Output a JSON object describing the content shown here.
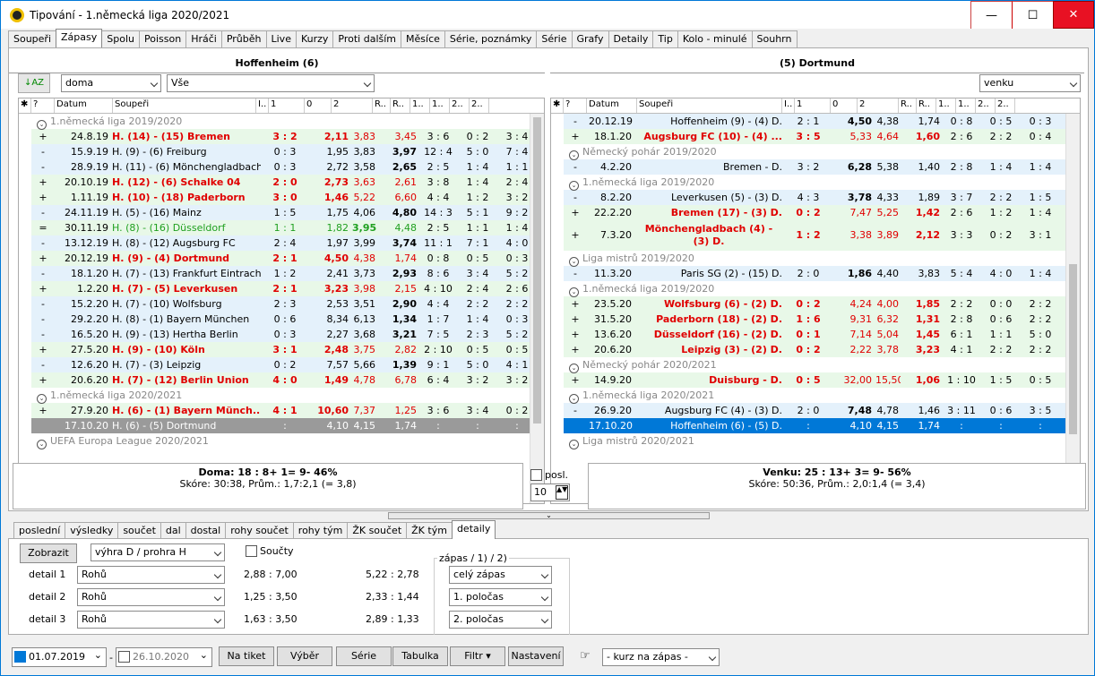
{
  "title": "Tipování - 1.německá liga 2020/2021",
  "tabs": [
    "Soupeři",
    "Zápasy",
    "Spolu",
    "Poisson",
    "Hráči",
    "Průběh",
    "Live",
    "Kurzy",
    "Proti dalším",
    "Měsíce",
    "Série, poznámky",
    "Série",
    "Grafy",
    "Detaily",
    "Tip",
    "Kolo - minulé",
    "Souhrn"
  ],
  "home": {
    "header": "Hoffenheim (6)",
    "filter1": "doma",
    "filter2": "Vše",
    "cols": [
      "?",
      "Datum",
      "Soupeři",
      "I..",
      "1",
      "0",
      "2",
      "R..",
      "R..",
      "1..",
      "1..",
      "2..",
      "2.."
    ],
    "rows": [
      {
        "t": "grp",
        "text": "1.německá liga 2019/2020"
      },
      {
        "c": "g",
        "s": "+",
        "d": "24.8.19",
        "o": "H. (14) - (15) Bremen",
        "red": true,
        "sc": "3 : 2",
        "k1": "2,11",
        "k0": "3,83",
        "k2": "3,45",
        "b": "1",
        "r": "3 : 6",
        "h": "0 : 2",
        "h2": "3 : 4"
      },
      {
        "c": "b",
        "s": "-",
        "d": "15.9.19",
        "o": "H. (9) - (6) Freiburg",
        "sc": "0 : 3",
        "k1": "1,95",
        "k0": "3,83",
        "k2": "3,97",
        "b": "2",
        "r": "12 : 4",
        "h": "5 : 0",
        "h2": "7 : 4"
      },
      {
        "c": "b",
        "s": "-",
        "d": "28.9.19",
        "o": "H. (11) - (6) Mönchengladbach",
        "sc": "0 : 3",
        "k1": "2,72",
        "k0": "3,58",
        "k2": "2,65",
        "b": "2",
        "r": "2 : 5",
        "h": "1 : 4",
        "h2": "1 : 1"
      },
      {
        "c": "g",
        "s": "+",
        "d": "20.10.19",
        "o": "H. (12) - (6) Schalke 04",
        "red": true,
        "sc": "2 : 0",
        "k1": "2,73",
        "k0": "3,63",
        "k2": "2,61",
        "b": "1",
        "r": "3 : 8",
        "h": "1 : 4",
        "h2": "2 : 4"
      },
      {
        "c": "g",
        "s": "+",
        "d": "1.11.19",
        "o": "H. (10) - (18) Paderborn",
        "red": true,
        "sc": "3 : 0",
        "k1": "1,46",
        "k0": "5,22",
        "k2": "6,60",
        "b": "1",
        "r": "4 : 4",
        "h": "1 : 2",
        "h2": "3 : 2"
      },
      {
        "c": "b",
        "s": "-",
        "d": "24.11.19",
        "o": "H. (5) - (16) Mainz",
        "sc": "1 : 5",
        "k1": "1,75",
        "k0": "4,06",
        "k2": "4,80",
        "b": "2",
        "r": "14 : 3",
        "h": "5 : 1",
        "h2": "9 : 2"
      },
      {
        "c": "g",
        "s": "=",
        "d": "30.11.19",
        "o": "H. (8) - (16) Düsseldorf",
        "grn": true,
        "sc": "1 : 1",
        "k1": "1,82",
        "k0": "3,95",
        "k2": "4,48",
        "b": "0",
        "r": "2 : 5",
        "h": "1 : 1",
        "h2": "1 : 4"
      },
      {
        "c": "b",
        "s": "-",
        "d": "13.12.19",
        "o": "H. (8) - (12) Augsburg FC",
        "sc": "2 : 4",
        "k1": "1,97",
        "k0": "3,99",
        "k2": "3,74",
        "b": "2",
        "r": "11 : 1",
        "h": "7 : 1",
        "h2": "4 : 0"
      },
      {
        "c": "g",
        "s": "+",
        "d": "20.12.19",
        "o": "H. (9) - (4) Dortmund",
        "red": true,
        "sc": "2 : 1",
        "k1": "4,50",
        "k0": "4,38",
        "k2": "1,74",
        "b": "1",
        "r": "0 : 8",
        "h": "0 : 5",
        "h2": "0 : 3"
      },
      {
        "c": "b",
        "s": "-",
        "d": "18.1.20",
        "o": "H. (7) - (13) Frankfurt Eintracht",
        "sc": "1 : 2",
        "k1": "2,41",
        "k0": "3,73",
        "k2": "2,93",
        "b": "2",
        "r": "8 : 6",
        "h": "3 : 4",
        "h2": "5 : 2"
      },
      {
        "c": "g",
        "s": "+",
        "d": "1.2.20",
        "o": "H. (7) - (5) Leverkusen",
        "red": true,
        "sc": "2 : 1",
        "k1": "3,23",
        "k0": "3,98",
        "k2": "2,15",
        "b": "1",
        "r": "4 : 10",
        "h": "2 : 4",
        "h2": "2 : 6"
      },
      {
        "c": "b",
        "s": "-",
        "d": "15.2.20",
        "o": "H. (7) - (10) Wolfsburg",
        "sc": "2 : 3",
        "k1": "2,53",
        "k0": "3,51",
        "k2": "2,90",
        "b": "2",
        "r": "4 : 4",
        "h": "2 : 2",
        "h2": "2 : 2"
      },
      {
        "c": "b",
        "s": "-",
        "d": "29.2.20",
        "o": "H. (8) - (1) Bayern München",
        "sc": "0 : 6",
        "k1": "8,34",
        "k0": "6,13",
        "k2": "1,34",
        "b": "2",
        "r": "1 : 7",
        "h": "1 : 4",
        "h2": "0 : 3"
      },
      {
        "c": "b",
        "s": "-",
        "d": "16.5.20",
        "o": "H. (9) - (13) Hertha Berlin",
        "sc": "0 : 3",
        "k1": "2,27",
        "k0": "3,68",
        "k2": "3,21",
        "b": "2",
        "r": "7 : 5",
        "h": "2 : 3",
        "h2": "5 : 2"
      },
      {
        "c": "g",
        "s": "+",
        "d": "27.5.20",
        "o": "H. (9) - (10) Köln",
        "red": true,
        "sc": "3 : 1",
        "k1": "2,48",
        "k0": "3,75",
        "k2": "2,82",
        "b": "1",
        "r": "2 : 10",
        "h": "0 : 5",
        "h2": "0 : 5"
      },
      {
        "c": "b",
        "s": "-",
        "d": "12.6.20",
        "o": "H. (7) - (3) Leipzig",
        "sc": "0 : 2",
        "k1": "7,57",
        "k0": "5,66",
        "k2": "1,39",
        "b": "2",
        "r": "9 : 1",
        "h": "5 : 0",
        "h2": "4 : 1"
      },
      {
        "c": "g",
        "s": "+",
        "d": "20.6.20",
        "o": "H. (7) - (12) Berlin Union",
        "red": true,
        "sc": "4 : 0",
        "k1": "1,49",
        "k0": "4,78",
        "k2": "6,78",
        "b": "1",
        "r": "6 : 4",
        "h": "3 : 2",
        "h2": "3 : 2"
      },
      {
        "t": "grp",
        "text": "1.německá liga 2020/2021"
      },
      {
        "c": "g",
        "s": "+",
        "d": "27.9.20",
        "o": "H. (6) - (1) Bayern Münch...",
        "red": true,
        "sc": "4 : 1",
        "k1": "10,60",
        "k0": "7,37",
        "k2": "1,25",
        "b": "1",
        "r": "3 : 6",
        "h": "3 : 4",
        "h2": "0 : 2"
      },
      {
        "c": "gray",
        "s": "",
        "d": "17.10.20",
        "o": "H. (6) - (5) Dortmund",
        "sc": ":",
        "k1": "4,10",
        "k0": "4,15",
        "k2": "1,74",
        "b": "",
        "r": ":",
        "h": ":",
        "h2": ":"
      },
      {
        "t": "grp",
        "text": "UEFA Europa League 2020/2021"
      }
    ]
  },
  "away": {
    "header": "(5) Dortmund",
    "filter1": "venku",
    "rows": [
      {
        "c": "b",
        "s": "-",
        "d": "20.12.19",
        "o": "Hoffenheim (9) - (4) D.",
        "sc": "2 : 1",
        "k1": "4,50",
        "k0": "4,38",
        "k2": "1,74",
        "b": "1",
        "r": "0 : 8",
        "h": "0 : 5",
        "h2": "0 : 3"
      },
      {
        "c": "g",
        "s": "+",
        "d": "18.1.20",
        "o": "Augsburg FC (10) - (4) ...",
        "red": true,
        "sc": "3 : 5",
        "k1": "5,33",
        "k0": "4,64",
        "k2": "1,60",
        "b": "2",
        "r": "2 : 6",
        "h": "2 : 2",
        "h2": "0 : 4"
      },
      {
        "t": "grp",
        "text": "Německý pohár 2019/2020"
      },
      {
        "c": "b",
        "s": "-",
        "d": "4.2.20",
        "o": "Bremen - D.",
        "sc": "3 : 2",
        "k1": "6,28",
        "k0": "5,38",
        "k2": "1,40",
        "b": "1",
        "r": "2 : 8",
        "h": "1 : 4",
        "h2": "1 : 4"
      },
      {
        "t": "grp",
        "text": "1.německá liga 2019/2020"
      },
      {
        "c": "b",
        "s": "-",
        "d": "8.2.20",
        "o": "Leverkusen (5) - (3) D.",
        "sc": "4 : 3",
        "k1": "3,78",
        "k0": "4,33",
        "k2": "1,89",
        "b": "1",
        "r": "3 : 7",
        "h": "2 : 2",
        "h2": "1 : 5"
      },
      {
        "c": "g",
        "s": "+",
        "d": "22.2.20",
        "o": "Bremen (17) - (3) D.",
        "red": true,
        "sc": "0 : 2",
        "k1": "7,47",
        "k0": "5,25",
        "k2": "1,42",
        "b": "2",
        "r": "2 : 6",
        "h": "1 : 2",
        "h2": "1 : 4"
      },
      {
        "c": "g",
        "s": "+",
        "d": "7.3.20",
        "o": "Mönchengladbach (4) - (3) D.",
        "red": true,
        "tall": true,
        "sc": "1 : 2",
        "k1": "3,38",
        "k0": "3,89",
        "k2": "2,12",
        "b": "2",
        "r": "3 : 3",
        "h": "0 : 2",
        "h2": "3 : 1"
      },
      {
        "t": "grp",
        "text": "Liga mistrů 2019/2020"
      },
      {
        "c": "b",
        "s": "-",
        "d": "11.3.20",
        "o": "Paris SG (2) - (15) D.",
        "sc": "2 : 0",
        "k1": "1,86",
        "k0": "4,40",
        "k2": "3,83",
        "b": "1",
        "r": "5 : 4",
        "h": "4 : 0",
        "h2": "1 : 4"
      },
      {
        "t": "grp",
        "text": "1.německá liga 2019/2020"
      },
      {
        "c": "g",
        "s": "+",
        "d": "23.5.20",
        "o": "Wolfsburg (6) - (2) D.",
        "red": true,
        "sc": "0 : 2",
        "k1": "4,24",
        "k0": "4,00",
        "k2": "1,85",
        "b": "2",
        "r": "2 : 2",
        "h": "0 : 0",
        "h2": "2 : 2"
      },
      {
        "c": "g",
        "s": "+",
        "d": "31.5.20",
        "o": "Paderborn (18) - (2) D.",
        "red": true,
        "sc": "1 : 6",
        "k1": "9,31",
        "k0": "6,32",
        "k2": "1,31",
        "b": "2",
        "r": "2 : 8",
        "h": "0 : 6",
        "h2": "2 : 2"
      },
      {
        "c": "g",
        "s": "+",
        "d": "13.6.20",
        "o": "Düsseldorf (16) - (2) D.",
        "red": true,
        "sc": "0 : 1",
        "k1": "7,14",
        "k0": "5,04",
        "k2": "1,45",
        "b": "2",
        "r": "6 : 1",
        "h": "1 : 1",
        "h2": "5 : 0"
      },
      {
        "c": "g",
        "s": "+",
        "d": "20.6.20",
        "o": "Leipzig (3) - (2) D.",
        "red": true,
        "sc": "0 : 2",
        "k1": "2,22",
        "k0": "3,78",
        "k2": "3,23",
        "b": "2",
        "r": "4 : 1",
        "h": "2 : 2",
        "h2": "2 : 2"
      },
      {
        "t": "grp",
        "text": "Německý pohár 2020/2021"
      },
      {
        "c": "g",
        "s": "+",
        "d": "14.9.20",
        "o": "Duisburg - D.",
        "red": true,
        "sc": "0 : 5",
        "k1": "32,00",
        "k0": "15,50",
        "k2": "1,06",
        "b": "2",
        "r": "1 : 10",
        "h": "1 : 5",
        "h2": "0 : 5"
      },
      {
        "t": "grp",
        "text": "1.německá liga 2020/2021"
      },
      {
        "c": "b",
        "s": "-",
        "d": "26.9.20",
        "o": "Augsburg FC (4) - (3) D.",
        "sc": "2 : 0",
        "k1": "7,48",
        "k0": "4,78",
        "k2": "1,46",
        "b": "1",
        "r": "3 : 11",
        "h": "0 : 6",
        "h2": "3 : 5"
      },
      {
        "c": "sel",
        "s": "",
        "d": "17.10.20",
        "o": "Hoffenheim (6) - (5) D.",
        "sc": ":",
        "k1": "4,10",
        "k0": "4,15",
        "k2": "1,74",
        "b": "",
        "r": ":",
        "h": ":",
        "h2": ":"
      },
      {
        "t": "grp",
        "text": "Liga mistrů 2020/2021"
      }
    ]
  },
  "summary": {
    "home_line1": "Doma: 18 : 8+ 1= 9- 46%",
    "home_line2": "Skóre: 30:38, Prům.: 1,7:2,1 (= 3,8)",
    "away_line1": "Venku: 25 : 13+ 3= 9- 56%",
    "away_line2": "Skóre: 50:36, Prům.: 2,0:1,4 (= 3,4)",
    "posl_label": "posl.",
    "posl_value": "10"
  },
  "bottom_tabs": [
    "poslední",
    "výsledky",
    "součet",
    "dal",
    "dostal",
    "rohy součet",
    "rohy tým",
    "ŽK součet",
    "ŽK tým",
    "detaily"
  ],
  "detail": {
    "show_btn": "Zobrazit",
    "mode": "výhra D / prohra H",
    "sums_label": "Součty",
    "section_label": "zápas / 1) / 2)",
    "rows": [
      {
        "label": "detail 1",
        "type": "Rohů",
        "v1": "2,88 : 7,00",
        "v2": "5,22 : 2,78",
        "part": "celý zápas"
      },
      {
        "label": "detail 2",
        "type": "Rohů",
        "v1": "1,25 : 3,50",
        "v2": "2,33 : 1,44",
        "part": "1. poločas"
      },
      {
        "label": "detail 3",
        "type": "Rohů",
        "v1": "1,63 : 3,50",
        "v2": "2,89 : 1,33",
        "part": "2. poločas"
      }
    ]
  },
  "footer": {
    "date_from": "01.07.2019",
    "date_to": "26.10.2020",
    "btn_ticket": "Na tiket",
    "btn_select": "Výběr",
    "btn_series": "Série",
    "btn_table": "Tabulka",
    "btn_filter": "Filtr ▾",
    "btn_settings": "Nastavení",
    "odds_select": "- kurz na zápas -"
  },
  "colors": {
    "accent": "#0078d7",
    "win_green": "#e8f8e8",
    "loss_blue": "#e4f1fb",
    "highlight_red": "#e00000"
  }
}
